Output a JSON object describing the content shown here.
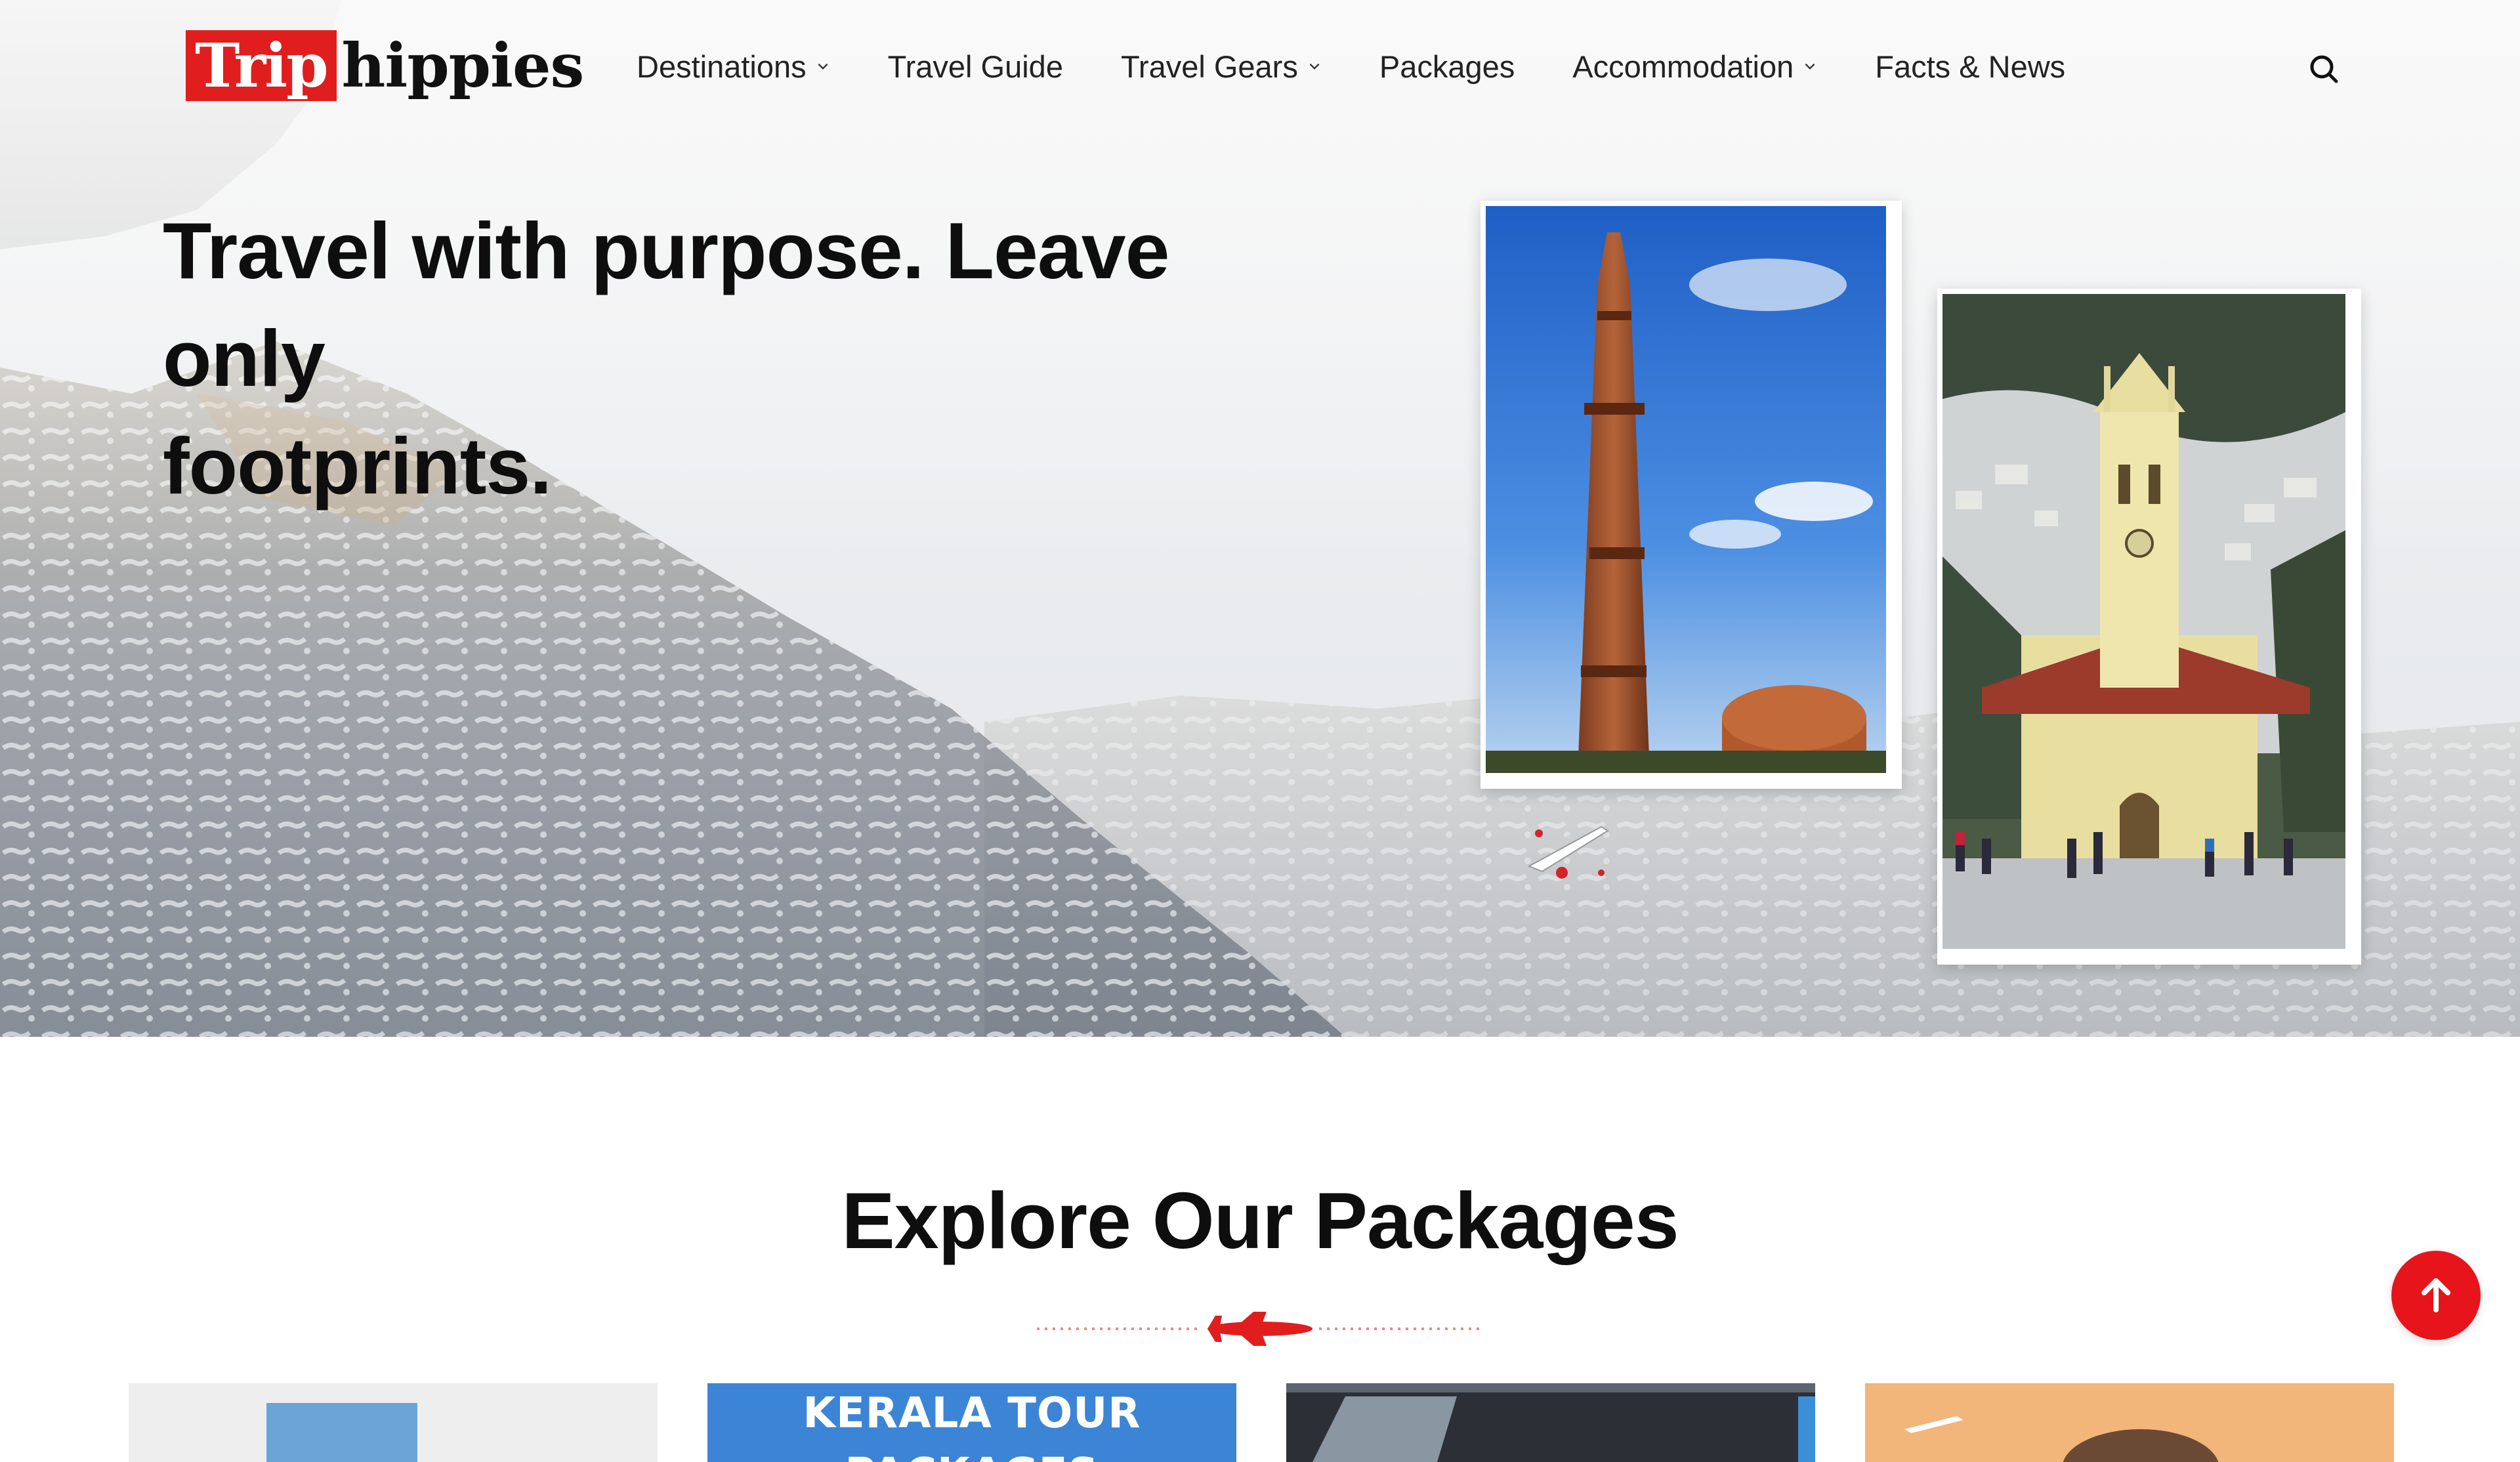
{
  "brand": {
    "logo_part1": "Trip",
    "logo_part2": "hippies",
    "accent_color": "#e01e1e"
  },
  "nav": {
    "items": [
      {
        "label": "Destinations",
        "has_dropdown": true
      },
      {
        "label": "Travel Guide",
        "has_dropdown": false
      },
      {
        "label": "Travel Gears",
        "has_dropdown": true
      },
      {
        "label": "Packages",
        "has_dropdown": false
      },
      {
        "label": "Accommodation",
        "has_dropdown": true
      },
      {
        "label": "Facts & News",
        "has_dropdown": false
      }
    ],
    "search_icon": "search-icon"
  },
  "hero": {
    "headline_line1": "Travel with purpose. Leave only",
    "headline_line2": "footprints.",
    "photos": [
      "qutub-minar-photo",
      "shimla-church-photo"
    ]
  },
  "packages": {
    "title": "Explore Our Packages",
    "cards": [
      {
        "label": ""
      },
      {
        "label": "KERALA TOUR PACKAGES"
      },
      {
        "label": ""
      },
      {
        "label": ""
      }
    ]
  },
  "scroll_top_icon": "arrow-up-icon"
}
